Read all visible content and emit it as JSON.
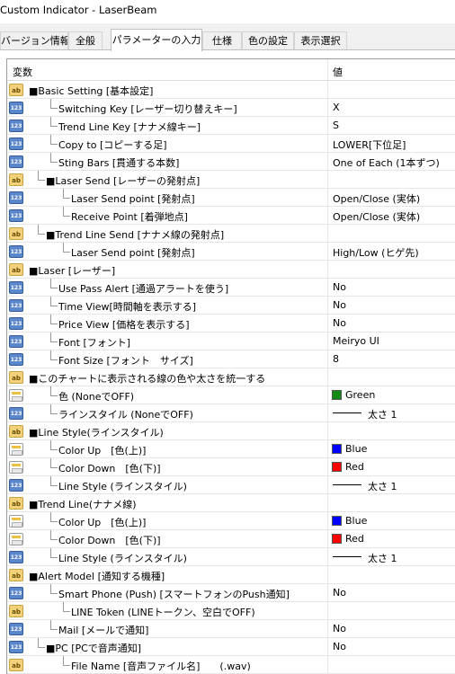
{
  "window": {
    "title": "Custom Indicator - LaserBeam"
  },
  "tabs": [
    {
      "label": "バージョン情報"
    },
    {
      "label": "全般"
    },
    {
      "label": "パラメーターの入力"
    },
    {
      "label": "仕様"
    },
    {
      "label": "色の設定"
    },
    {
      "label": "表示選択"
    }
  ],
  "grid": {
    "header": {
      "name": "変数",
      "value": "値"
    },
    "rows": [
      {
        "icon": "ab",
        "label": "■Basic Setting [基本設定]",
        "value": ""
      },
      {
        "icon": "num",
        "label": "Switching Key [レーザー切り替えキー]",
        "value": "X"
      },
      {
        "icon": "num",
        "label": "Trend Line Key [ナナメ線キー]",
        "value": "S"
      },
      {
        "icon": "num",
        "label": "Copy to [コピーする足]",
        "value": "LOWER[下位足]"
      },
      {
        "icon": "num",
        "label": "Sting Bars [貫通する本数]",
        "value": "One of Each (1本ずつ)"
      },
      {
        "icon": "ab",
        "label": "■Laser Send [レーザーの発射点]",
        "value": ""
      },
      {
        "icon": "num",
        "label": "Laser Send point [発射点]",
        "value": "Open/Close (実体)"
      },
      {
        "icon": "num",
        "label": "Receive Point [着弾地点]",
        "value": "Open/Close (実体)"
      },
      {
        "icon": "ab",
        "label": "■Trend Line Send [ナナメ線の発射点]",
        "value": ""
      },
      {
        "icon": "num",
        "label": "Laser Send point [発射点]",
        "value": "High/Low (ヒゲ先)"
      },
      {
        "icon": "ab",
        "label": "■Laser [レーザー]",
        "value": ""
      },
      {
        "icon": "num",
        "label": "Use Pass Alert [通過アラートを使う]",
        "value": "No"
      },
      {
        "icon": "num",
        "label": "Time View[時間軸を表示する]",
        "value": "No"
      },
      {
        "icon": "num",
        "label": "Price View [価格を表示する]",
        "value": "No"
      },
      {
        "icon": "num",
        "label": "Font [フォント]",
        "value": "Meiryo UI"
      },
      {
        "icon": "num",
        "label": "Font Size [フォント　サイズ]",
        "value": "8"
      },
      {
        "icon": "ab",
        "label": "■このチャートに表示される線の色や太さを統一する",
        "value": ""
      },
      {
        "icon": "col",
        "label": "色 (NoneでOFF)",
        "value": "Green",
        "swatch": "#138a13"
      },
      {
        "icon": "num",
        "label": "ラインスタイル (NoneでOFF)",
        "value": "太さ 1",
        "line": true
      },
      {
        "icon": "ab",
        "label": "■Line Style(ラインスタイル)",
        "value": ""
      },
      {
        "icon": "col",
        "label": "Color Up　[色(上)]",
        "value": "Blue",
        "swatch": "#0000ff"
      },
      {
        "icon": "col",
        "label": "Color Down　[色(下)]",
        "value": "Red",
        "swatch": "#ff0000"
      },
      {
        "icon": "num",
        "label": "Line Style (ラインスタイル)",
        "value": "太さ 1",
        "line": true
      },
      {
        "icon": "ab",
        "label": "■Trend Line(ナナメ線)",
        "value": ""
      },
      {
        "icon": "col",
        "label": "Color Up　[色(上)]",
        "value": "Blue",
        "swatch": "#0000ff"
      },
      {
        "icon": "col",
        "label": "Color Down　[色(下)]",
        "value": "Red",
        "swatch": "#ff0000"
      },
      {
        "icon": "num",
        "label": "Line Style (ラインスタイル)",
        "value": "太さ 1",
        "line": true
      },
      {
        "icon": "ab",
        "label": "■Alert Model [通知する機種]",
        "value": ""
      },
      {
        "icon": "num",
        "label": "Smart Phone (Push) [スマートフォンのPush通知]",
        "value": "No"
      },
      {
        "icon": "ab",
        "label": "LINE Token (LINEトークン、空白でOFF)",
        "value": ""
      },
      {
        "icon": "num",
        "label": "Mail [メールで通知]",
        "value": "No"
      },
      {
        "icon": "num",
        "label": "■PC [PCで音声通知]",
        "value": "No"
      },
      {
        "icon": "ab",
        "label": "File Name [音声ファイル名]　　(.wav)",
        "value": ""
      }
    ]
  }
}
